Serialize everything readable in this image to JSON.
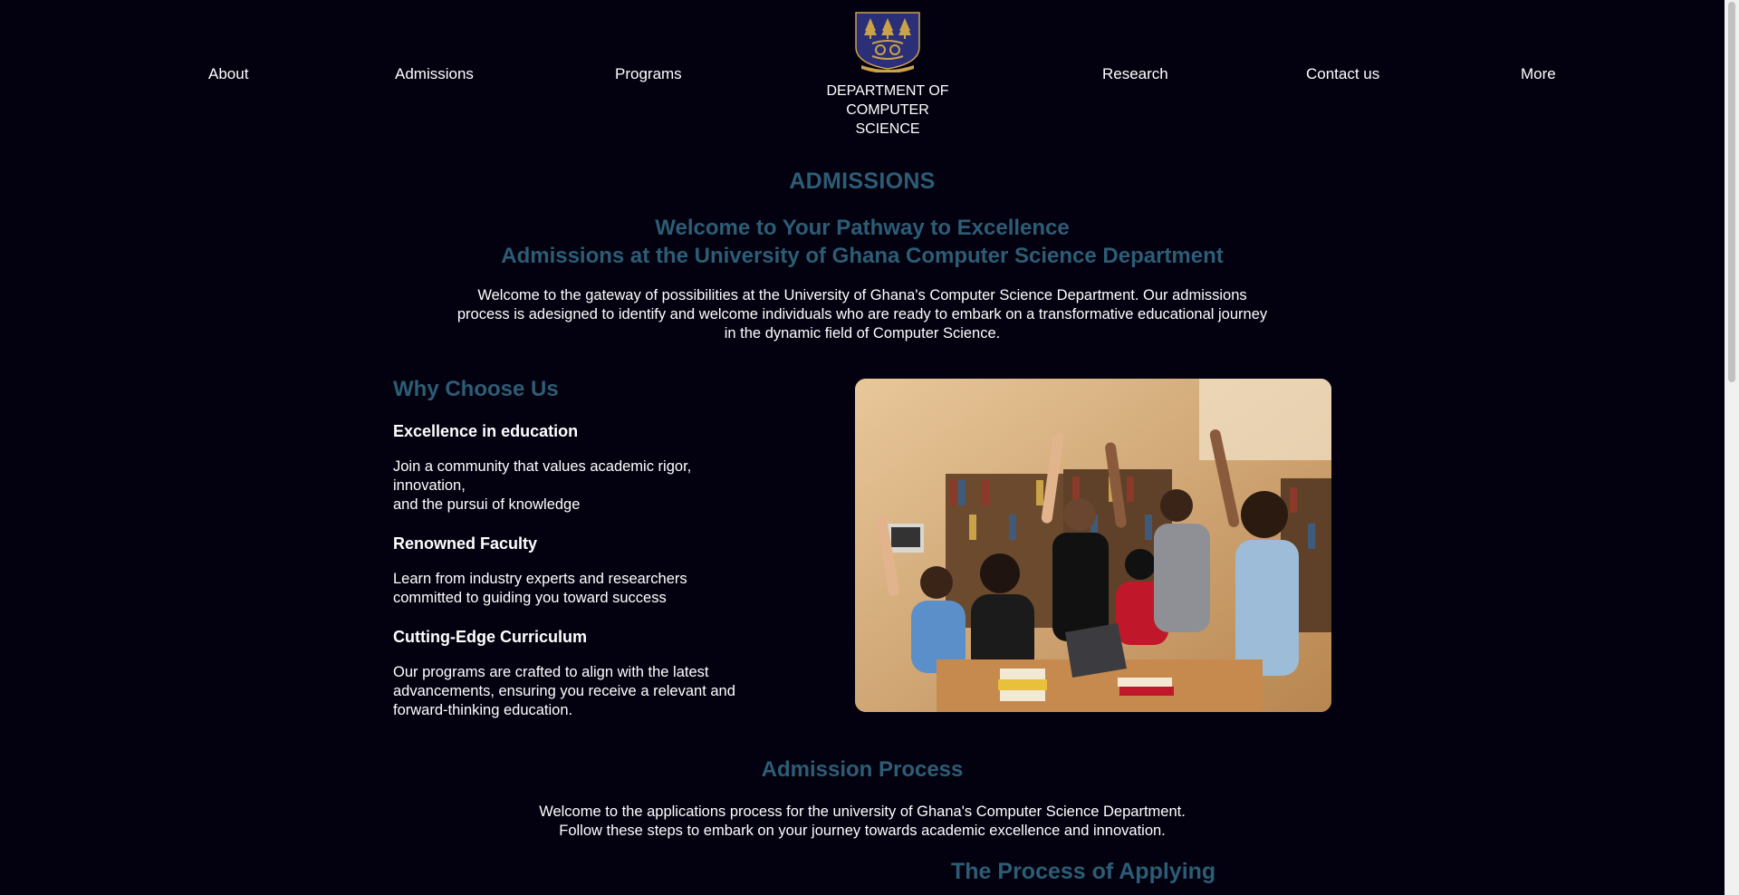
{
  "nav": {
    "about": "About",
    "admissions": "Admissions",
    "programs": "Programs",
    "research": "Research",
    "contact": "Contact us",
    "more": "More"
  },
  "logo": {
    "dept_line1": "DEPARTMENT OF",
    "dept_line2": "COMPUTER SCIENCE",
    "icon": "university-crest-icon"
  },
  "hero": {
    "title": "ADMISSIONS",
    "welcome_line1": "Welcome to Your Pathway to Excellence",
    "welcome_line2": "Admissions at the University of Ghana Computer Science Department",
    "intro": "Welcome to the gateway of possibilities at the University of Ghana's Computer Science Department. Our admissions process is adesigned to identify and welcome individuals who are ready to embark on a transformative educational journey in the dynamic field of Computer Science."
  },
  "why": {
    "title": "Why Choose Us",
    "reasons": [
      {
        "title": "Excellence in education",
        "text": "Join a community that values academic rigor,\ninnovation,\nand the pursui of knowledge"
      },
      {
        "title": "Renowned Faculty",
        "text": "Learn from industry experts and researchers\ncommitted to guiding you toward success"
      },
      {
        "title": "Cutting-Edge Curriculum",
        "text": "Our programs are crafted to align with the latest\nadvancements, ensuring you receive a relevant and\nforward-thinking education."
      }
    ]
  },
  "process": {
    "title": "Admission Process",
    "text_line1": "Welcome to the applications process for the university of Ghana's Computer Science Department.",
    "text_line2": "Follow these steps to embark on your journey towards academic excellence and innovation.",
    "applying_title": "The Process of Applying"
  },
  "colors": {
    "background": "#03010f",
    "heading": "#2c5d75",
    "text": "#ffffff",
    "crest_blue": "#2b2f78",
    "crest_gold": "#c9a24a"
  }
}
